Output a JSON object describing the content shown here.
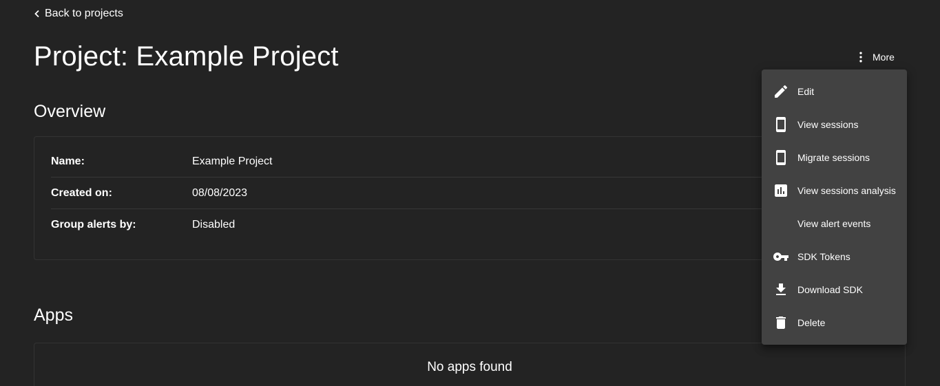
{
  "nav": {
    "back_label": "Back to projects"
  },
  "header": {
    "title": "Project: Example Project",
    "more_label": "More"
  },
  "overview": {
    "title": "Overview",
    "rows": [
      {
        "label": "Name:",
        "value": "Example Project"
      },
      {
        "label": "Created on:",
        "value": "08/08/2023"
      },
      {
        "label": "Group alerts by:",
        "value": "Disabled"
      }
    ]
  },
  "apps": {
    "title": "Apps",
    "empty_message": "No apps found"
  },
  "menu": {
    "items": [
      {
        "label": "Edit",
        "icon": "pencil-icon"
      },
      {
        "label": "View sessions",
        "icon": "smartphone-icon"
      },
      {
        "label": "Migrate sessions",
        "icon": "smartphone-icon"
      },
      {
        "label": "View sessions analysis",
        "icon": "bar-chart-icon"
      },
      {
        "label": "View alert events",
        "icon": ""
      },
      {
        "label": "SDK Tokens",
        "icon": "key-icon"
      },
      {
        "label": "Download SDK",
        "icon": "download-icon"
      },
      {
        "label": "Delete",
        "icon": "trash-icon"
      }
    ]
  },
  "colors": {
    "background": "#232323",
    "card_border": "#333333",
    "menu_background": "#424242",
    "text": "#ffffff"
  }
}
